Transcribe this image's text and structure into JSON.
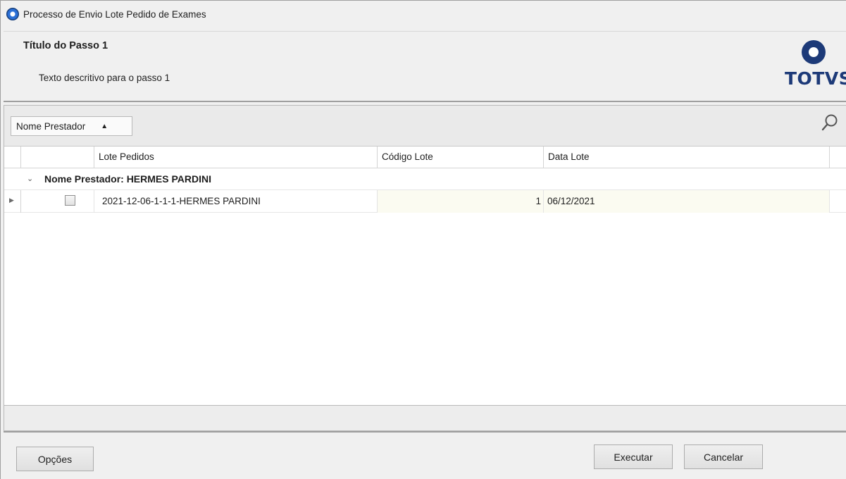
{
  "window": {
    "title": "Processo de Envio Lote Pedido de Exames",
    "icon": "totvs-app-icon"
  },
  "header": {
    "step_title": "Título do Passo 1",
    "step_description": "Texto descritivo para o passo 1",
    "logo_text": "TOTVS",
    "logo_color": "#1d3a78"
  },
  "grid": {
    "group_by_chip": {
      "label": "Nome Prestador",
      "sort_icon": "sort-ascending-icon"
    },
    "search_icon": "search-icon",
    "columns": [
      "Lote Pedidos",
      "Código Lote",
      "Data Lote"
    ],
    "groups": [
      {
        "label": "Nome Prestador: HERMES PARDINI",
        "expanded": true,
        "rows": [
          {
            "checked": false,
            "lote_pedidos": "2021-12-06-1-1-1-HERMES PARDINI",
            "codigo_lote": "1",
            "data_lote": "06/12/2021"
          }
        ]
      }
    ]
  },
  "buttons": {
    "opcoes": "Opções",
    "executar": "Executar",
    "cancelar": "Cancelar"
  }
}
